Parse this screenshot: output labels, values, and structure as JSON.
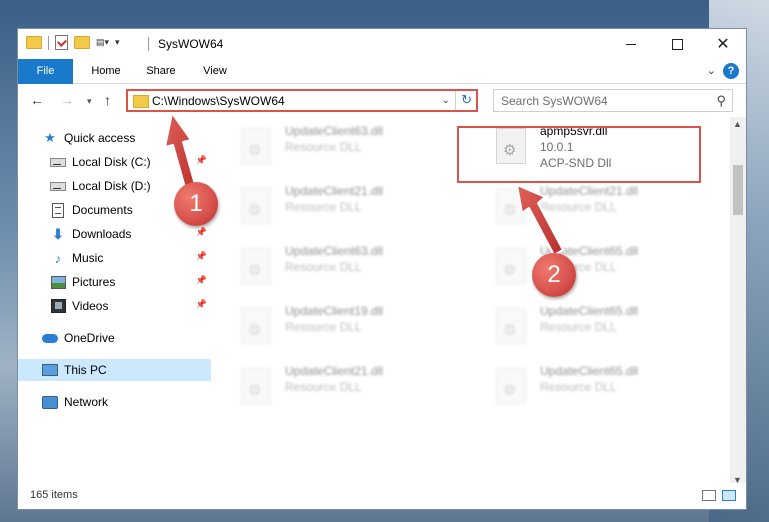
{
  "window": {
    "title": "SysWOW64",
    "controls": {
      "minimize_icon": "minimize-icon",
      "maximize_icon": "maximize-icon",
      "close_label": "✕"
    }
  },
  "ribbon": {
    "tabs": [
      {
        "label": "File"
      },
      {
        "label": "Home"
      },
      {
        "label": "Share"
      },
      {
        "label": "View"
      }
    ],
    "help_label": "?"
  },
  "navbar": {
    "address": "C:\\Windows\\SysWOW64",
    "search_placeholder": "Search SysWOW64"
  },
  "sidebar": {
    "items": [
      {
        "label": "Quick access"
      },
      {
        "label": "Local Disk (C:)"
      },
      {
        "label": "Local Disk (D:)"
      },
      {
        "label": "Documents"
      },
      {
        "label": "Downloads"
      },
      {
        "label": "Music"
      },
      {
        "label": "Pictures"
      },
      {
        "label": "Videos"
      },
      {
        "label": "OneDrive"
      },
      {
        "label": "This PC"
      },
      {
        "label": "Network"
      }
    ]
  },
  "files": {
    "highlighted": {
      "name": "apmp5svr.dll",
      "version": "10.0.1",
      "description": "ACP-SND Dll"
    },
    "left": [
      {
        "name": "UpdateClient63.dll",
        "type": "Resource DLL"
      },
      {
        "name": "UpdateClient21.dll",
        "type": "Resource DLL"
      },
      {
        "name": "UpdateClient63.dll",
        "type": "Resource DLL"
      },
      {
        "name": "UpdateClient19.dll",
        "type": "Resource DLL"
      },
      {
        "name": "UpdateClient21.dll",
        "type": "Resource DLL"
      }
    ],
    "right": [
      {
        "name": "UpdateClient21.dll",
        "type": "Resource DLL"
      },
      {
        "name": "UpdateClient65.dll",
        "type": "Resource DLL"
      },
      {
        "name": "UpdateClient65.dll",
        "type": "Resource DLL"
      },
      {
        "name": "UpdateClient65.dll",
        "type": "Resource DLL"
      }
    ]
  },
  "status": {
    "count": "165 items"
  },
  "annotations": {
    "badge1": "1",
    "badge2": "2",
    "accent": "#d9534f"
  }
}
